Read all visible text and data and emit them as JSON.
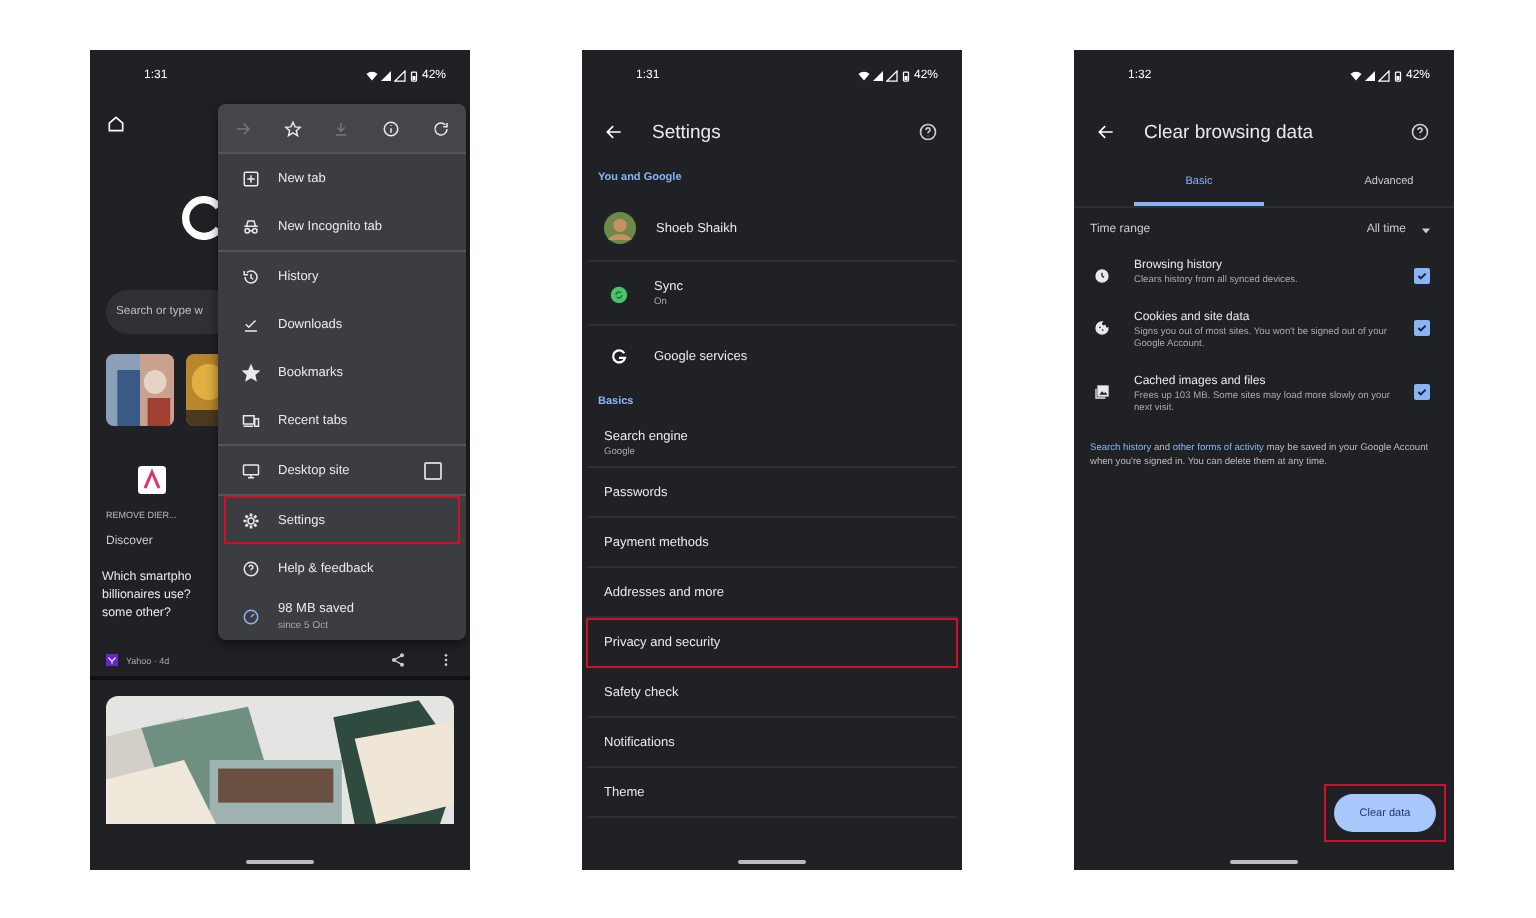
{
  "home_screen": {
    "status": {
      "time": "1:31",
      "battery": "42%"
    },
    "search": {
      "placeholder": "Search or type w"
    },
    "shortcut": {
      "label": "REMOVE DIER..."
    },
    "discover": "Discover",
    "article": {
      "lines": [
        "Which smartpho",
        "billionaires use?",
        "some other?"
      ],
      "source": "Yahoo · 4d"
    },
    "menu": {
      "toolbar": [
        {
          "disabled": true
        },
        {
          "disabled": false
        },
        {
          "disabled": true
        },
        {
          "disabled": false
        },
        {
          "disabled": false
        }
      ],
      "groups": [
        [
          {
            "kind": "item",
            "label": "New tab",
            "highlighted": false
          },
          {
            "kind": "item",
            "label": "New Incognito tab",
            "highlighted": false
          }
        ],
        [
          {
            "kind": "item",
            "label": "History",
            "highlighted": false
          },
          {
            "kind": "item",
            "label": "Downloads",
            "highlighted": false
          },
          {
            "kind": "item",
            "label": "Bookmarks",
            "highlighted": false
          },
          {
            "kind": "item",
            "label": "Recent tabs",
            "highlighted": false
          }
        ],
        [
          {
            "kind": "toggle",
            "label": "Desktop site",
            "checked": false,
            "highlighted": false
          }
        ],
        [
          {
            "kind": "item",
            "label": "Settings",
            "highlighted": true
          },
          {
            "kind": "item",
            "label": "Help & feedback",
            "highlighted": false
          },
          {
            "kind": "saved",
            "label": "98 MB saved",
            "detail": "since 5 Oct",
            "highlighted": false
          }
        ]
      ]
    }
  },
  "settings_screen": {
    "status": {
      "time": "1:31",
      "battery": "42%"
    },
    "title": "Settings",
    "sections": [
      {
        "header": "You and Google",
        "items": [
          {
            "kind": "account",
            "label": "Shoeb Shaikh",
            "highlighted": false
          },
          {
            "kind": "sync",
            "label": "Sync",
            "detail": "On",
            "highlighted": false
          },
          {
            "kind": "google",
            "label": "Google services",
            "highlighted": false
          }
        ]
      },
      {
        "header": "Basics",
        "items": [
          {
            "kind": "plain",
            "label": "Search engine",
            "detail": "Google",
            "highlighted": false
          },
          {
            "kind": "plain",
            "label": "Passwords",
            "highlighted": false
          },
          {
            "kind": "plain",
            "label": "Payment methods",
            "highlighted": false
          },
          {
            "kind": "plain",
            "label": "Addresses and more",
            "highlighted": false
          },
          {
            "kind": "plain",
            "label": "Privacy and security",
            "highlighted": true
          },
          {
            "kind": "plain",
            "label": "Safety check",
            "highlighted": false
          },
          {
            "kind": "plain",
            "label": "Notifications",
            "highlighted": false
          },
          {
            "kind": "plain",
            "label": "Theme",
            "highlighted": false
          }
        ]
      }
    ]
  },
  "clear_data_screen": {
    "status": {
      "time": "1:32",
      "battery": "42%"
    },
    "title": "Clear browsing data",
    "tabs": [
      {
        "label": "Basic",
        "selected": true
      },
      {
        "label": "Advanced",
        "selected": false
      }
    ],
    "time_range": {
      "label": "Time range",
      "value": "All time"
    },
    "items": [
      {
        "label": "Browsing history",
        "detail": "Clears history from all synced devices.",
        "checked": true
      },
      {
        "label": "Cookies and site data",
        "detail": "Signs you out of most sites. You won't be signed out of your Google Account.",
        "checked": true
      },
      {
        "label": "Cached images and files",
        "detail": "Frees up 103 MB. Some sites may load more slowly on your next visit.",
        "checked": true
      }
    ],
    "note": [
      {
        "kind": "link",
        "text": "Search history"
      },
      {
        "kind": "text",
        "text": " and "
      },
      {
        "kind": "link",
        "text": "other forms of activity"
      },
      {
        "kind": "text",
        "text": " may be saved in your Google Account when you're signed in. You can delete them at any time."
      }
    ],
    "button": {
      "label": "Clear data",
      "highlighted": true
    }
  }
}
